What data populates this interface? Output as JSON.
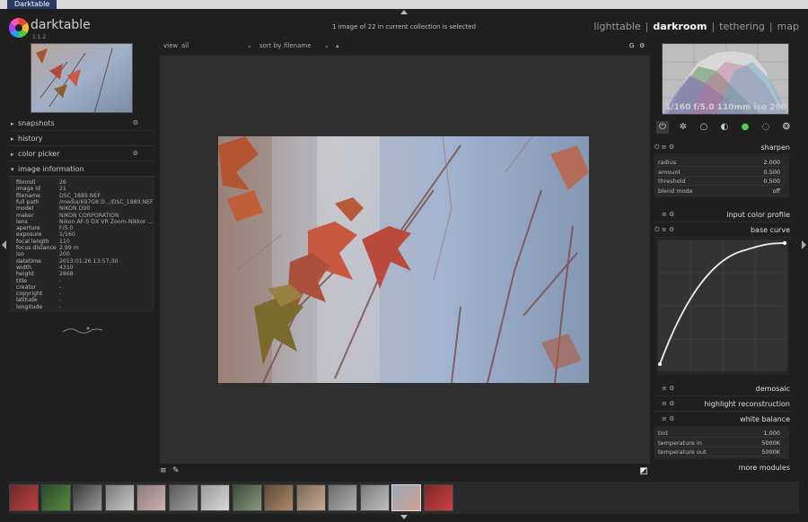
{
  "window": {
    "tab_title": "Darktable"
  },
  "header": {
    "app_name": "darktable",
    "app_version": "1.1.2",
    "status": "1 image of 22 in current collection is selected",
    "views": [
      "lighttable",
      "darkroom",
      "tethering",
      "map"
    ],
    "active_view": "darkroom"
  },
  "left_panel": {
    "sections": [
      {
        "label": "snapshots"
      },
      {
        "label": "history"
      },
      {
        "label": "color picker"
      },
      {
        "label": "image information"
      }
    ],
    "image_info": [
      {
        "key": "filmroll",
        "value": "26"
      },
      {
        "key": "image id",
        "value": "21"
      },
      {
        "key": "filename",
        "value": "DSC_1889.NEF"
      },
      {
        "key": "full path",
        "value": "/media/697G8 D.../DSC_1889.NEF"
      },
      {
        "key": "model",
        "value": "NIKON D90"
      },
      {
        "key": "maker",
        "value": "NIKON CORPORATION"
      },
      {
        "key": "lens",
        "value": "Nikon AF-S DX VR Zoom-Nikkor ..."
      },
      {
        "key": "aperture",
        "value": "F/5.0"
      },
      {
        "key": "exposure",
        "value": "1/160"
      },
      {
        "key": "focal length",
        "value": "110"
      },
      {
        "key": "focus distance",
        "value": "2.99 m"
      },
      {
        "key": "iso",
        "value": "200"
      },
      {
        "key": "datetime",
        "value": "2013:01:26 13:57:30"
      },
      {
        "key": "width",
        "value": "4310"
      },
      {
        "key": "height",
        "value": "2868"
      },
      {
        "key": "title",
        "value": "-"
      },
      {
        "key": "creator",
        "value": "-"
      },
      {
        "key": "copyright",
        "value": "-"
      },
      {
        "key": "latitude",
        "value": "-"
      },
      {
        "key": "longitude",
        "value": "-"
      }
    ]
  },
  "center_toolbar": {
    "view_label": "view",
    "view_value": "all",
    "sort_label": "sort by",
    "sort_value": "filename",
    "grouping": "G"
  },
  "right_panel": {
    "histogram_text": "1/160 f/5.0 110mm iso 200",
    "modules": {
      "sharpen": "sharpen",
      "input_color_profile": "input color profile",
      "base_curve": "base curve",
      "demosaic": "demosaic",
      "highlight_reconstruction": "highlight reconstruction",
      "white_balance": "white balance",
      "more_modules": "more modules"
    },
    "sharpen_params": [
      {
        "label": "radius",
        "value": "2.000"
      },
      {
        "label": "amount",
        "value": "0.500"
      },
      {
        "label": "threshold",
        "value": "0.500"
      },
      {
        "label": "blend mode",
        "value": "off"
      }
    ],
    "white_balance_params": [
      {
        "label": "tint",
        "value": "1.000"
      },
      {
        "label": "temperature in",
        "value": "5000K"
      },
      {
        "label": "temperature out",
        "value": "5000K"
      }
    ]
  },
  "filmstrip": {
    "count": 14,
    "selected_index": 12
  }
}
